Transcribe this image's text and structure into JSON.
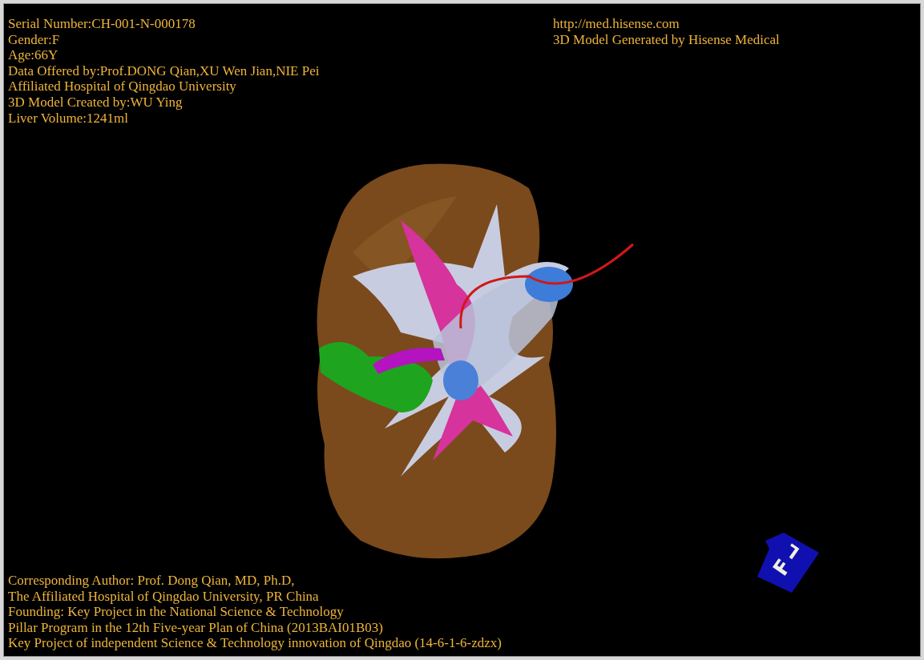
{
  "info_lines": [
    "Serial Number:CH-001-N-000178",
    "Gender:F",
    "Age:66Y",
    "Data Offered by:Prof.DONG Qian,XU Wen Jian,NIE Pei",
    "Affiliated Hospital of Qingdao University",
    "3D Model Created by:WU Ying",
    "Liver Volume:1241ml"
  ],
  "credit_lines": [
    "http://med.hisense.com",
    "3D Model Generated by Hisense Medical"
  ],
  "orientation_cube": {
    "faces": [
      "F",
      "L"
    ]
  },
  "footer_lines": [
    "Corresponding Author: Prof. Dong Qian, MD, Ph.D,",
    "The Affiliated Hospital of Qingdao University, PR China",
    "Founding: Key Project in the National Science & Technology",
    "Pillar Program in the 12th Five-year Plan of China (2013BAI01B03)",
    "Key Project of independent Science & Technology innovation of Qingdao (14-6-1-6-zdzx)"
  ]
}
